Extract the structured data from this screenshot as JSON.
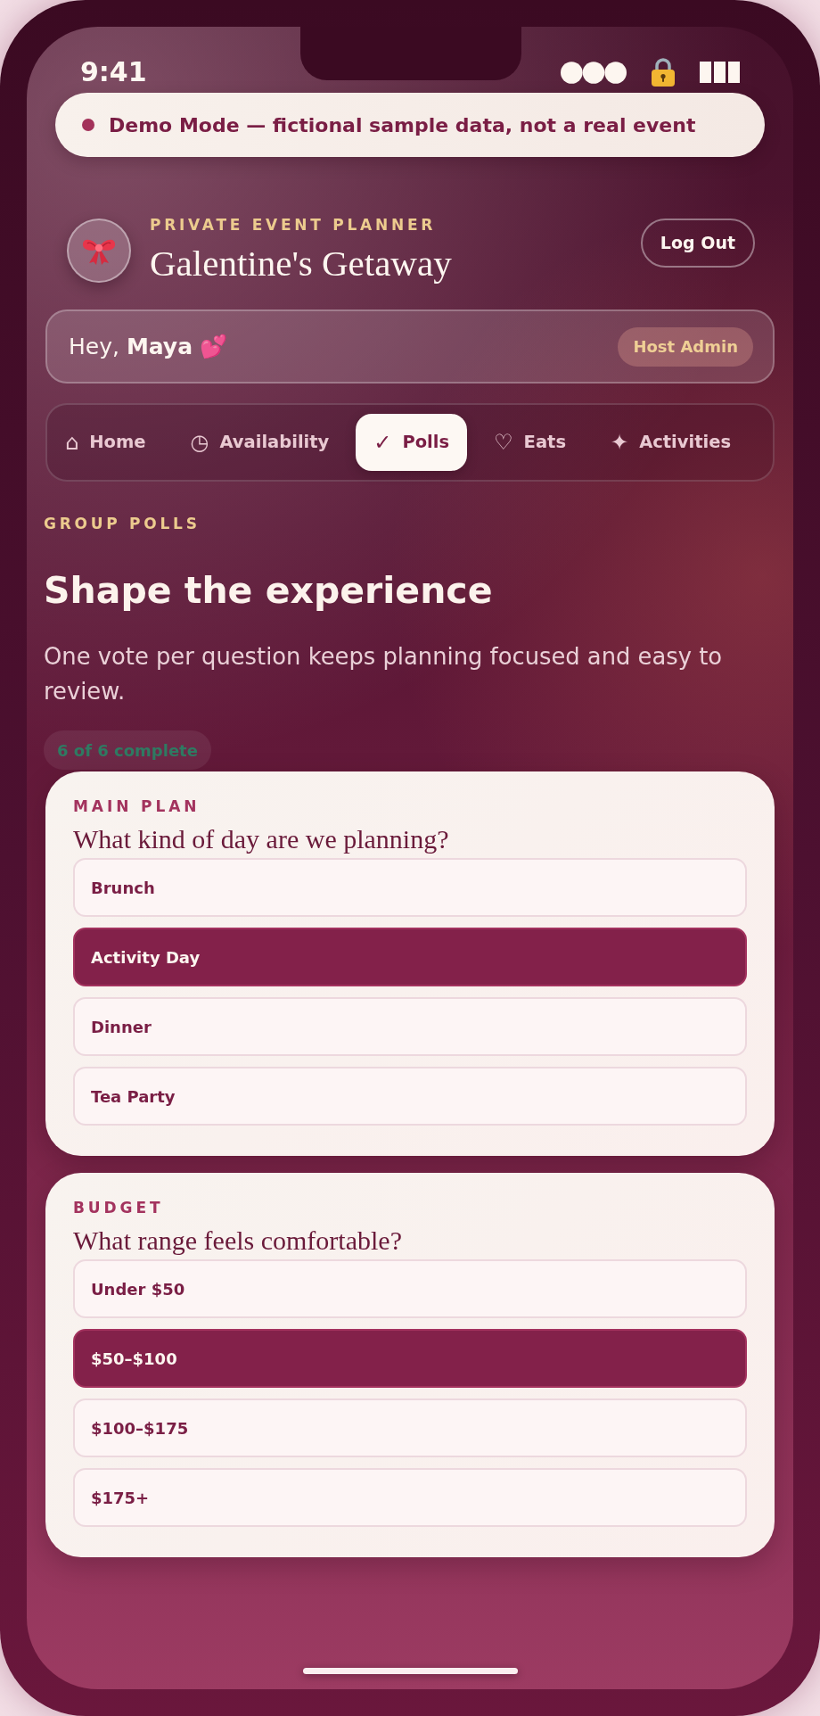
{
  "status_bar": {
    "time": "9:41"
  },
  "demo_banner": {
    "text": "Demo Mode — fictional sample data, not a real event"
  },
  "header": {
    "eyebrow": "PRIVATE EVENT PLANNER",
    "title": "Galentine's Getaway",
    "logout_button": "Log Out"
  },
  "greeting": {
    "text": "Hey, **Maya** 💕",
    "role_badge": "Host Admin"
  },
  "tabs": [
    {
      "icon": "⌂",
      "label": "Home",
      "selected": false
    },
    {
      "icon": "◷",
      "label": "Availability",
      "selected": false
    },
    {
      "icon": "✓",
      "label": "Polls",
      "selected": true
    },
    {
      "icon": "♡",
      "label": "Eats",
      "selected": false
    },
    {
      "icon": "✦",
      "label": "Activities",
      "selected": false
    }
  ],
  "section": {
    "eyebrow": "GROUP POLLS",
    "title": "Shape the experience",
    "description": "One vote per question keeps planning focused and easy to review.",
    "progress_badge": "6 of 6 complete"
  },
  "polls": [
    {
      "category": "MAIN PLAN",
      "question": "What kind of day are we planning?",
      "options": [
        {
          "label": "Brunch",
          "selected": false
        },
        {
          "label": "Activity Day",
          "selected": true
        },
        {
          "label": "Dinner",
          "selected": false
        },
        {
          "label": "Tea Party",
          "selected": false
        }
      ]
    },
    {
      "category": "BUDGET",
      "question": "What range feels comfortable?",
      "options": [
        {
          "label": "Under $50",
          "selected": false
        },
        {
          "label": "$50–$100",
          "selected": true
        },
        {
          "label": "$100–$175",
          "selected": false
        },
        {
          "label": "$175+",
          "selected": false
        }
      ]
    }
  ]
}
